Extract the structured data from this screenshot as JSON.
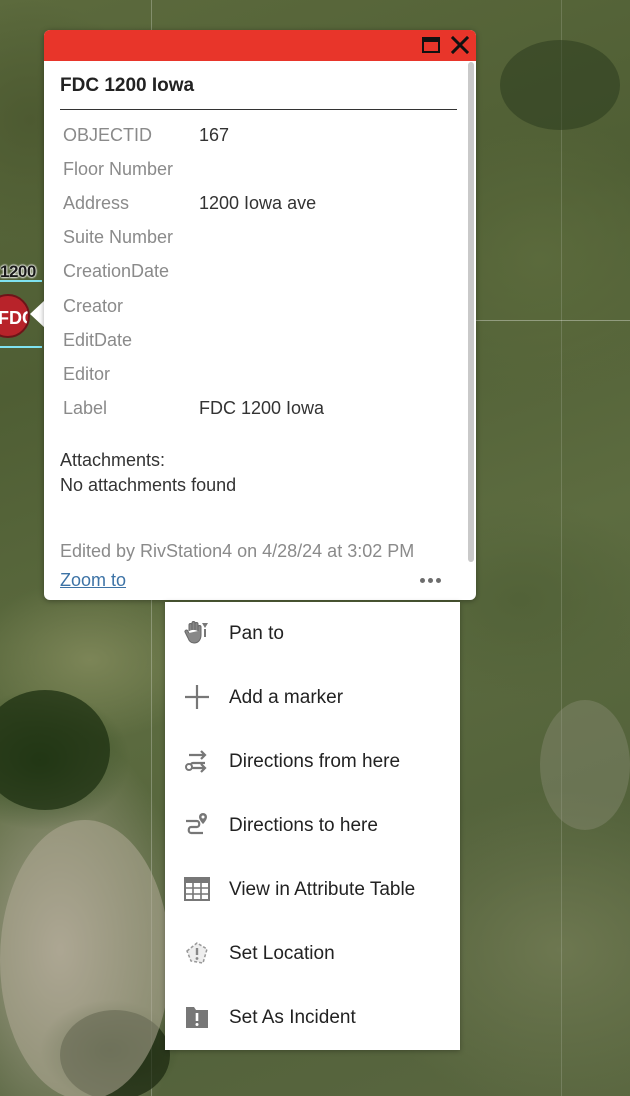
{
  "map": {
    "feature_label": "1200",
    "marker_text": "FDC"
  },
  "popup": {
    "title": "FDC 1200 Iowa",
    "maximize_icon": "maximize-icon",
    "close_icon": "close-icon",
    "attributes": [
      {
        "name": "OBJECTID",
        "value": "167"
      },
      {
        "name": "Floor Number",
        "value": ""
      },
      {
        "name": "Address",
        "value": "1200 Iowa ave"
      },
      {
        "name": "Suite Number",
        "value": ""
      },
      {
        "name": "CreationDate",
        "value": ""
      },
      {
        "name": "Creator",
        "value": ""
      },
      {
        "name": "EditDate",
        "value": ""
      },
      {
        "name": "Editor",
        "value": ""
      },
      {
        "name": "Label",
        "value": "FDC 1200 Iowa"
      }
    ],
    "attachments_heading": "Attachments:",
    "attachments_empty": "No attachments found",
    "edit_info": "Edited by RivStation4 on 4/28/24 at 3:02 PM",
    "zoom_to_label": "Zoom to",
    "colors": {
      "header": "#e8352a",
      "link": "#3d73a6"
    }
  },
  "actions_menu": {
    "items": [
      {
        "label": "Pan to",
        "icon": "pan-hand-icon"
      },
      {
        "label": "Add a marker",
        "icon": "plus-icon"
      },
      {
        "label": "Directions from here",
        "icon": "directions-from-icon"
      },
      {
        "label": "Directions to here",
        "icon": "directions-to-icon"
      },
      {
        "label": "View in Attribute Table",
        "icon": "table-icon"
      },
      {
        "label": "Set Location",
        "icon": "set-location-icon"
      },
      {
        "label": "Set As Incident",
        "icon": "incident-icon"
      }
    ]
  }
}
